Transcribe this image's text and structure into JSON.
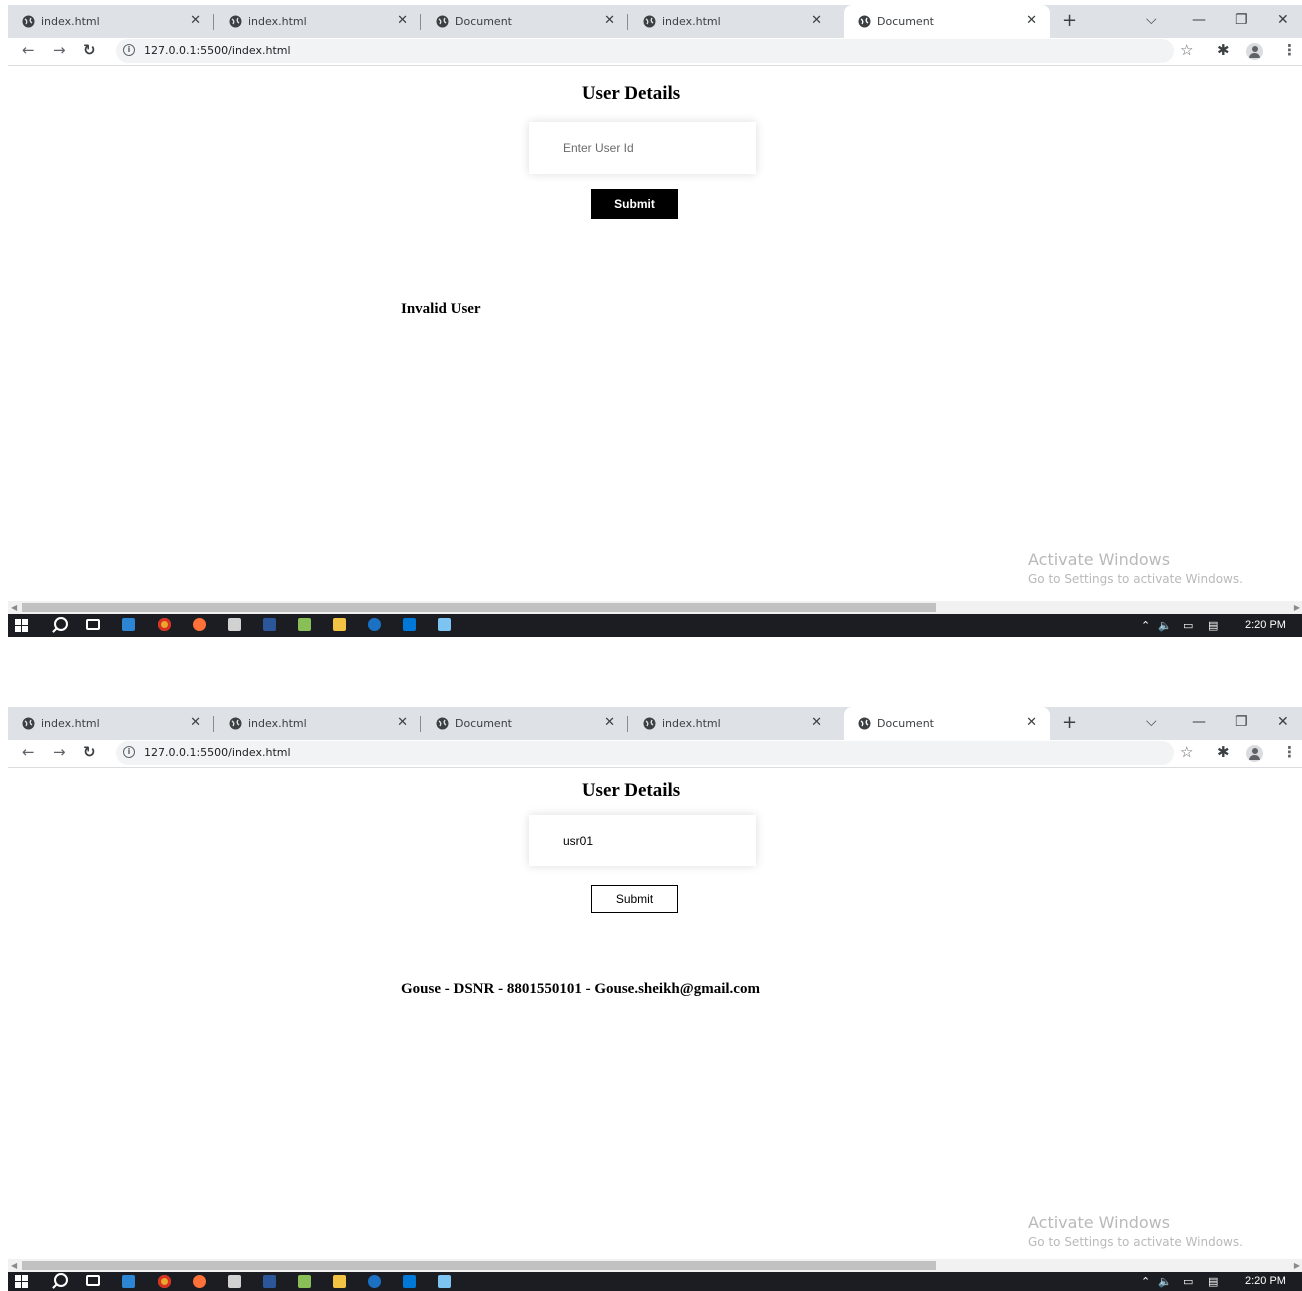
{
  "browser": {
    "tabs": [
      {
        "title": "index.html"
      },
      {
        "title": "index.html"
      },
      {
        "title": "Document"
      },
      {
        "title": "index.html"
      },
      {
        "title": "Document"
      }
    ],
    "active_tab_index": 4,
    "url": "127.0.0.1:5500/index.html"
  },
  "screens": [
    {
      "page_title": "User Details",
      "input_placeholder": "Enter User Id",
      "input_value": "",
      "submit_label": "Submit",
      "result_text": "Invalid User"
    },
    {
      "page_title": "User Details",
      "input_placeholder": "Enter User Id",
      "input_value": "usr01",
      "submit_label": "Submit",
      "result_text": "Gouse - DSNR - 8801550101 - Gouse.sheikh@gmail.com"
    }
  ],
  "watermark": {
    "title": "Activate Windows",
    "subtitle": "Go to Settings to activate Windows."
  },
  "taskbar": {
    "clock": "2:20 PM",
    "apps": [
      "windows-start-icon",
      "search-icon",
      "task-view-icon",
      "paint-icon",
      "chrome-icon",
      "firefox-icon",
      "acrobat-icon",
      "word-icon",
      "notepad-plus-icon",
      "file-explorer-icon",
      "edge-icon",
      "vscode-icon",
      "notepad-icon"
    ]
  },
  "colors": {
    "tab_strip": "#dee1e6",
    "taskbar": "#1c1d22",
    "submit_filled_bg": "#000000",
    "watermark_text": "#b9b9b9"
  }
}
